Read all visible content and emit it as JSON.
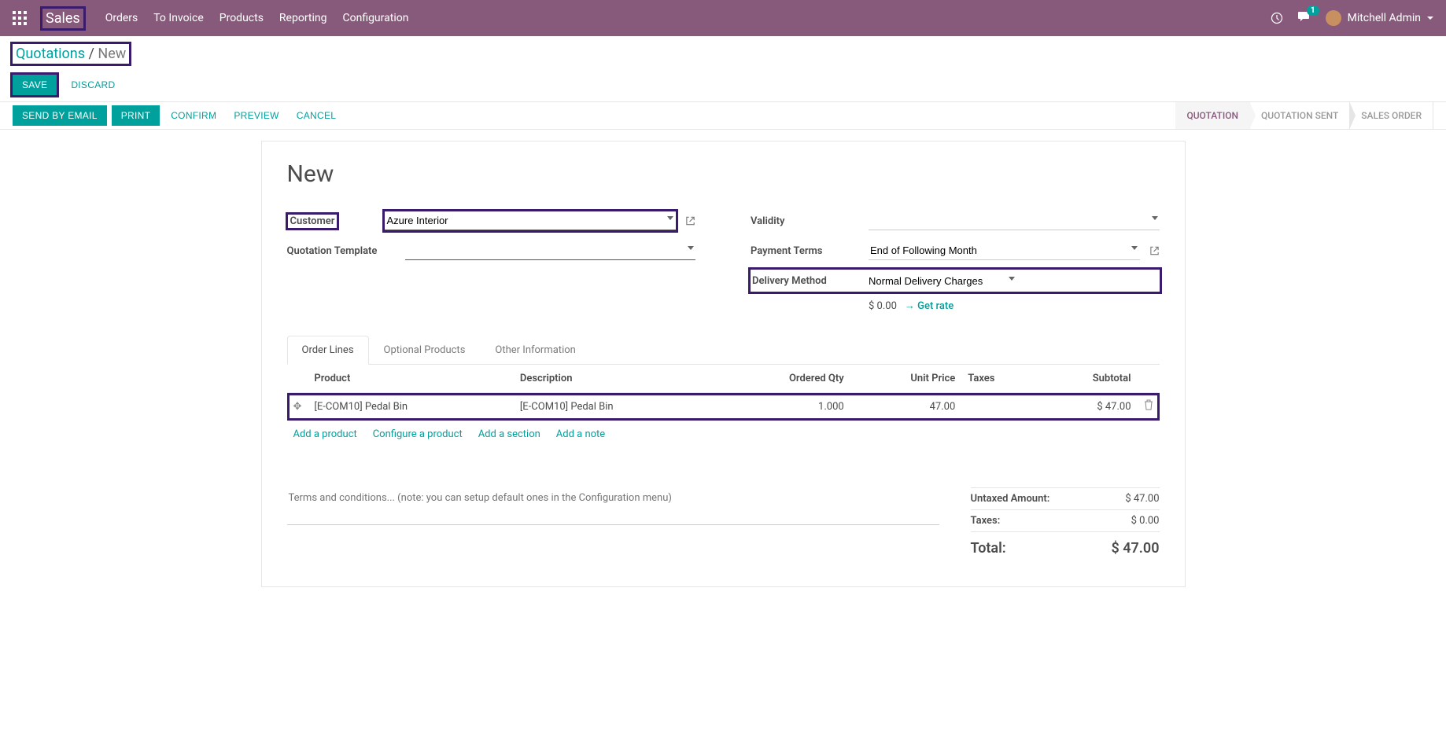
{
  "topnav": {
    "brand": "Sales",
    "menu": [
      "Orders",
      "To Invoice",
      "Products",
      "Reporting",
      "Configuration"
    ],
    "msg_count": "1",
    "user_name": "Mitchell Admin"
  },
  "breadcrumb": {
    "link": "Quotations",
    "sep": " / ",
    "current": "New"
  },
  "controls": {
    "save": "SAVE",
    "discard": "DISCARD"
  },
  "actions": {
    "send_email": "SEND BY EMAIL",
    "print": "PRINT",
    "confirm": "CONFIRM",
    "preview": "PREVIEW",
    "cancel": "CANCEL"
  },
  "status": {
    "quotation": "QUOTATION",
    "sent": "QUOTATION SENT",
    "order": "SALES ORDER"
  },
  "sheet": {
    "title": "New",
    "labels": {
      "customer": "Customer",
      "quotation_template": "Quotation Template",
      "validity": "Validity",
      "payment_terms": "Payment Terms",
      "delivery_method": "Delivery Method"
    },
    "fields": {
      "customer": "Azure Interior",
      "quotation_template": "",
      "validity": "",
      "payment_terms": "End of Following Month",
      "delivery_method": "Normal Delivery Charges"
    },
    "rate": {
      "amount": "$ 0.00",
      "link": "Get rate"
    }
  },
  "tabs": {
    "order_lines": "Order Lines",
    "optional": "Optional Products",
    "other": "Other Information"
  },
  "table": {
    "headers": {
      "product": "Product",
      "description": "Description",
      "qty": "Ordered Qty",
      "unit_price": "Unit Price",
      "taxes": "Taxes",
      "subtotal": "Subtotal"
    },
    "rows": [
      {
        "product": "[E-COM10] Pedal Bin",
        "description": "[E-COM10] Pedal Bin",
        "qty": "1.000",
        "unit_price": "47.00",
        "taxes": "",
        "subtotal": "$ 47.00"
      }
    ]
  },
  "add_links": {
    "product": "Add a product",
    "configure": "Configure a product",
    "section": "Add a section",
    "note": "Add a note"
  },
  "terms_placeholder": "Terms and conditions... (note: you can setup default ones in the Configuration menu)",
  "totals": {
    "untaxed_label": "Untaxed Amount:",
    "untaxed_value": "$ 47.00",
    "taxes_label": "Taxes:",
    "taxes_value": "$ 0.00",
    "total_label": "Total:",
    "total_value": "$ 47.00"
  }
}
